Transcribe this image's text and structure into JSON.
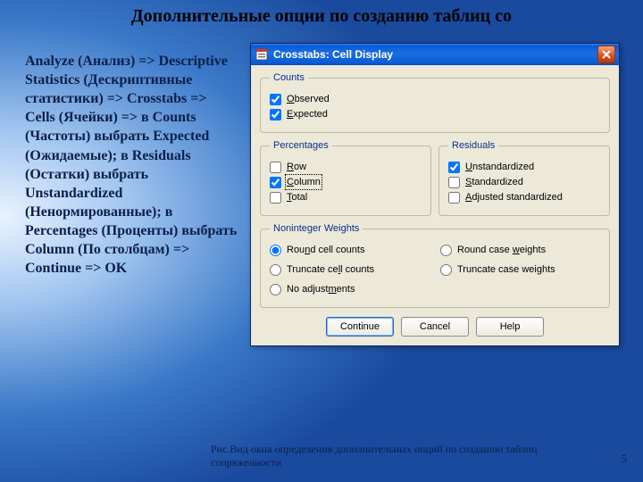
{
  "slide": {
    "title": "Дополнительные опции по созданию таблиц со",
    "instructions": "Analyze (Анализ) => Descriptive Statistics (Дескриптивные статистики) => Crosstabs => Cells (Ячейки) => в Counts (Частоты) выбрать Expected (Ожидаемые); в Residuals (Остатки) выбрать Unstandardized (Ненормированные); в Percentages (Проценты) выбрать Column (По столбцам) => Continue => OK",
    "caption": "Рис.Вид окна определения дополнительных опций по созданию таблиц сопряженности",
    "page": "5"
  },
  "dialog": {
    "title": "Crosstabs: Cell Display",
    "groups": {
      "counts": {
        "legend": "Counts",
        "observed": "Observed",
        "expected": "Expected"
      },
      "percentages": {
        "legend": "Percentages",
        "row": "Row",
        "column": "Column",
        "total": "Total"
      },
      "residuals": {
        "legend": "Residuals",
        "unstd": "Unstandardized",
        "std": "Standardized",
        "adj": "Adjusted standardized"
      },
      "weights": {
        "legend": "Noninteger Weights",
        "round_cell": "Round cell counts",
        "round_case": "Round case weights",
        "trunc_cell": "Truncate cell counts",
        "trunc_case": "Truncate case weights",
        "none": "No adjustments"
      }
    },
    "buttons": {
      "continue": "Continue",
      "cancel": "Cancel",
      "help": "Help"
    }
  }
}
